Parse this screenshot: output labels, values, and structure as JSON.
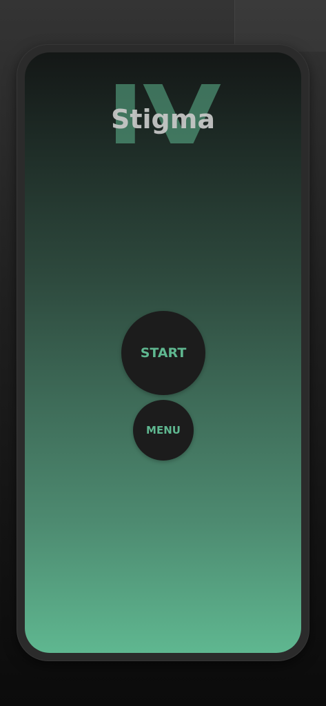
{
  "logo": {
    "roman_numeral": "IV",
    "title": "Stigma"
  },
  "buttons": {
    "start_label": "START",
    "menu_label": "MENU"
  },
  "colors": {
    "accent": "#5fb790",
    "button_bg": "#1c1c1c",
    "title_text": "#c9c9c9"
  }
}
